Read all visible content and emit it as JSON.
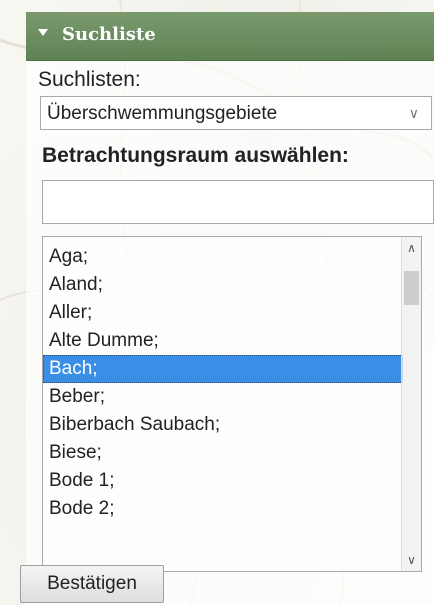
{
  "panel": {
    "title": "Suchliste",
    "header_color": "#6b8d60"
  },
  "search_lists": {
    "label": "Suchlisten:",
    "selected": "Überschwemmungsgebiete",
    "chevron_icon": "chevron-down-icon"
  },
  "area": {
    "label": "Betrachtungsraum auswählen:",
    "filter_value": ""
  },
  "list": {
    "items": [
      "Aga;",
      "Aland;",
      "Aller;",
      "Alte Dumme;",
      "Bach;",
      "Beber;",
      "Biberbach Saubach;",
      "Biese;",
      "Bode 1;",
      "Bode 2;"
    ],
    "selected_item": "Bach;",
    "selected_color": "#3b8ee6"
  },
  "confirm_button": {
    "label": "Bestätigen"
  }
}
